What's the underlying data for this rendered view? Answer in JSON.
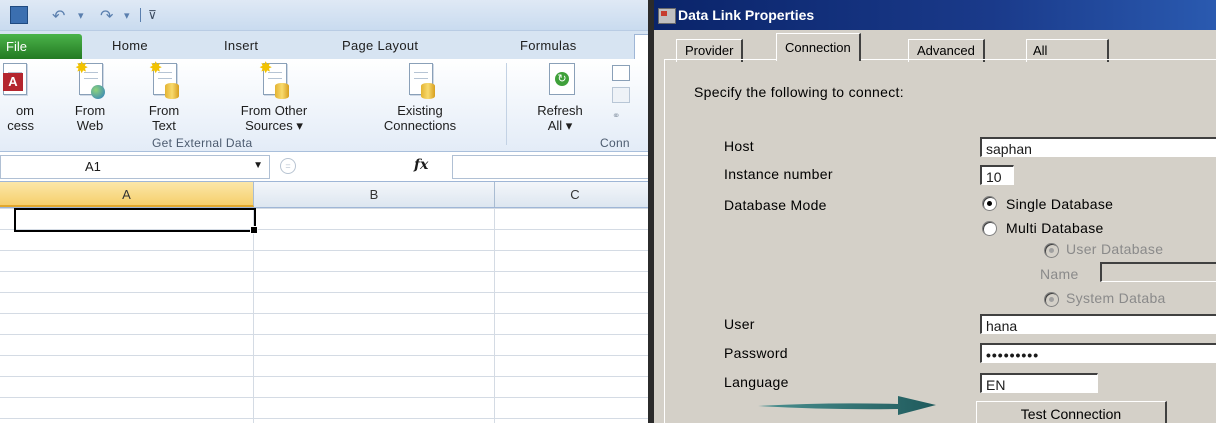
{
  "excel": {
    "ribbon_tabs": {
      "file": "File",
      "home": "Home",
      "insert": "Insert",
      "page_layout": "Page Layout",
      "formulas": "Formulas"
    },
    "ribbon_buttons": {
      "from_access_1": "om",
      "from_access_2": "cess",
      "from_web_1": "From",
      "from_web_2": "Web",
      "from_text_1": "From",
      "from_text_2": "Text",
      "from_other_1": "From Other",
      "from_other_2": "Sources ▾",
      "existing_1": "Existing",
      "existing_2": "Connections",
      "refresh_1": "Refresh",
      "refresh_2": "All ▾"
    },
    "groups": {
      "get_external_data": "Get External Data",
      "connections_partial": "Conn"
    },
    "formula_bar": {
      "name_box": "A1",
      "fx": "fx",
      "value": ""
    },
    "columns": [
      "A",
      "B",
      "C"
    ],
    "accent_colors": {
      "file_tab": "#2e8b2d",
      "selected_header": "#f6cf6c"
    }
  },
  "dialog": {
    "title": "Data Link Properties",
    "tabs": [
      "Provider",
      "Connection",
      "Advanced",
      "All"
    ],
    "active_tab": "Connection",
    "instruction": "Specify the following to connect:",
    "fields": {
      "host_label": "Host",
      "host_value": "saphan",
      "instance_label": "Instance number",
      "instance_value": "10",
      "mode_label": "Database Mode",
      "mode_single": "Single Database",
      "mode_multi": "Multi Database",
      "user_db": "User Database",
      "name_label": "Name",
      "system_db": "System Databa",
      "user_label": "User",
      "user_value": "hana",
      "password_label": "Password",
      "password_value": "•••••••••",
      "language_label": "Language",
      "language_value": "EN"
    },
    "selected_mode": "Single Database",
    "test_button": "Test Connection",
    "annotation_arrow_color": "#2e6e6e"
  }
}
